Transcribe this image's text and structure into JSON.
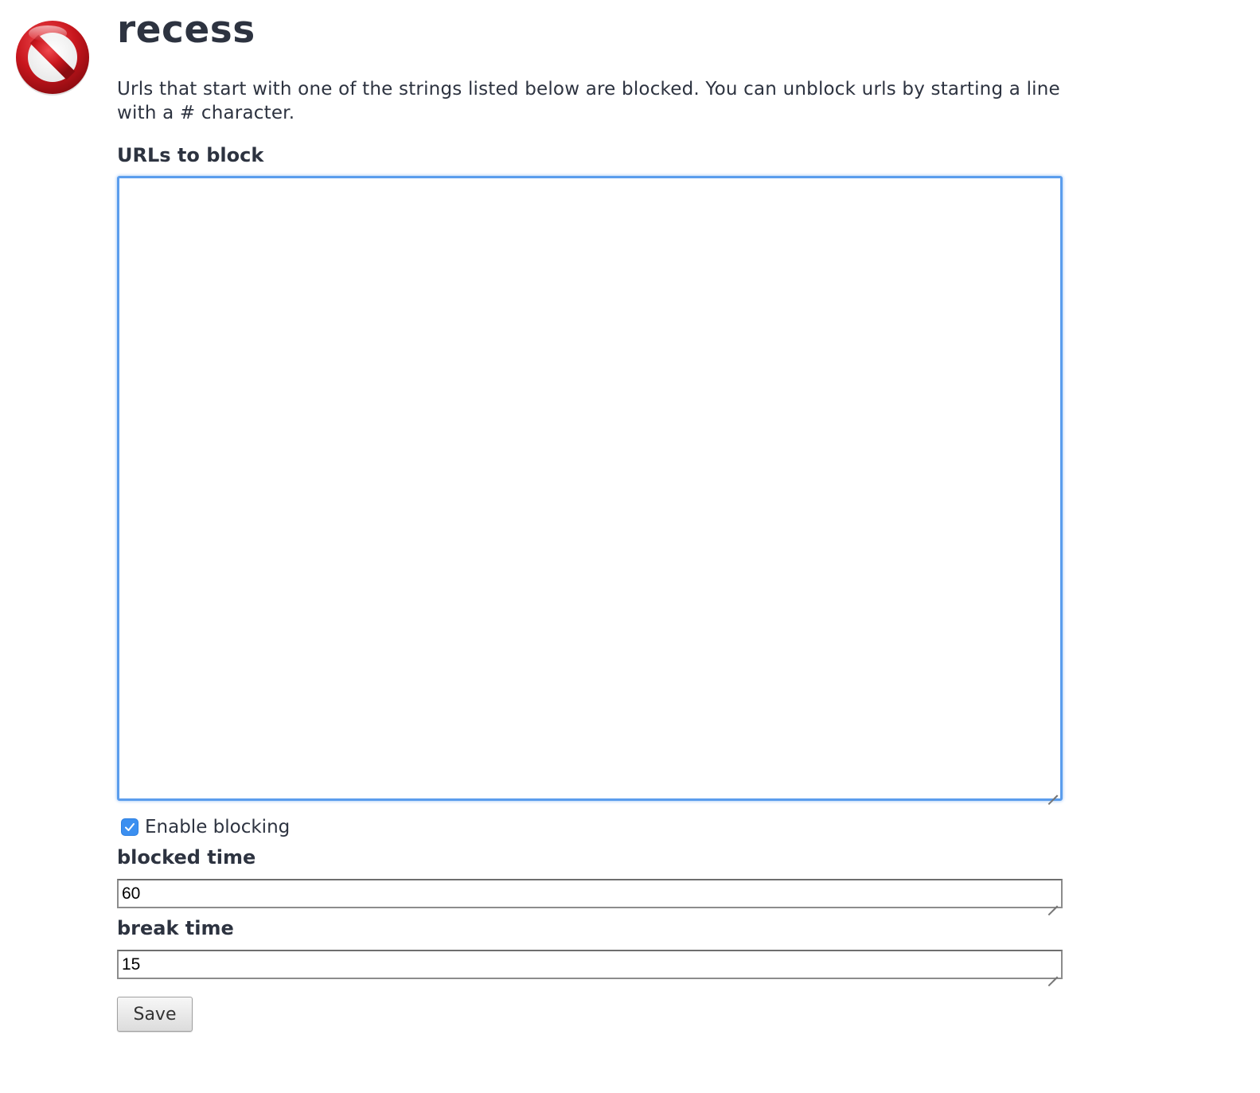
{
  "app": {
    "title": "recess",
    "logo_icon": "no-entry-icon",
    "description": "Urls that start with one of the strings listed below are blocked. You can unblock urls by starting a line with a # character."
  },
  "urls_field": {
    "label": "URLs to block",
    "value": ""
  },
  "enable_blocking": {
    "label": "Enable blocking",
    "checked": true,
    "accent_color": "#3b8ff0"
  },
  "blocked_time": {
    "label": "blocked time",
    "value": "60"
  },
  "break_time": {
    "label": "break time",
    "value": "15"
  },
  "save_button": {
    "label": "Save"
  },
  "colors": {
    "text": "#2d3340",
    "focus_border": "#5b9ded",
    "logo_red": "#c8161d"
  }
}
